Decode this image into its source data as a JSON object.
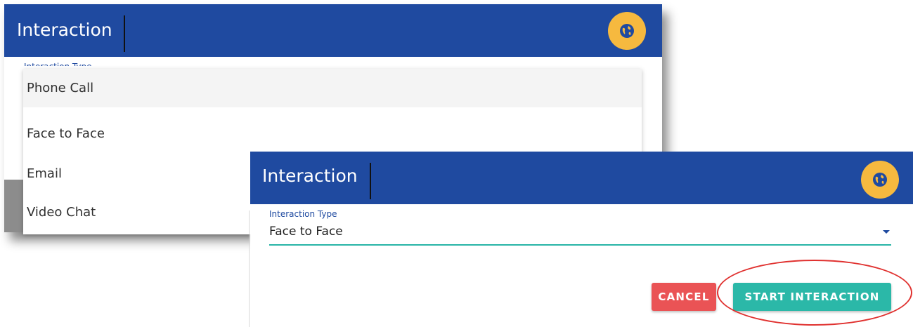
{
  "back_dialog": {
    "title": "Interaction",
    "field_label": "Interaction Type",
    "globe_icon": "globe-icon",
    "dropdown_options": [
      "Phone Call",
      "Face to Face",
      "Email",
      "Video Chat"
    ],
    "highlighted_option": "Phone Call"
  },
  "front_dialog": {
    "title": "Interaction",
    "field_label": "Interaction Type",
    "selected_value": "Face to Face",
    "globe_icon": "globe-icon",
    "cancel_label": "CANCEL",
    "start_label": "START INTERACTION"
  },
  "colors": {
    "header_blue": "#1f4aa0",
    "globe_yellow": "#f6b93f",
    "cancel_red": "#ea5355",
    "start_teal": "#2bb8a8",
    "highlight_red": "#e0312f"
  }
}
